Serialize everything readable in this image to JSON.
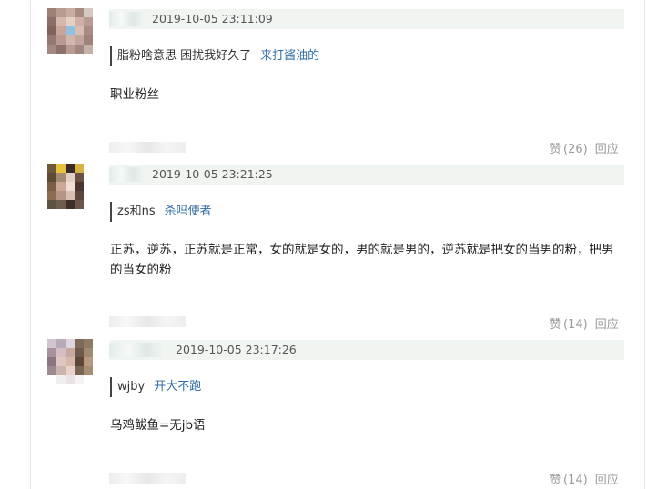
{
  "comments": [
    {
      "timestamp": "2019-10-05 23:11:09",
      "quote_user": "脂粉啥意思 困扰我好久了",
      "quote_text": "来打酱油的",
      "body": "职业粉丝",
      "like_label": "赞",
      "like_count": "(26)",
      "reply_label": "回应"
    },
    {
      "timestamp": "2019-10-05 23:21:25",
      "quote_user": "zs和ns",
      "quote_text": "杀吗使者",
      "body": "正苏，逆苏，正苏就是正常，女的就是女的，男的就是男的，逆苏就是把女的当男的粉，把男的当女的粉",
      "like_label": "赞",
      "like_count": "(14)",
      "reply_label": "回应"
    },
    {
      "timestamp": "2019-10-05 23:17:26",
      "quote_user": "wjby",
      "quote_text": "开大不跑",
      "body": "乌鸡鲅鱼=无jb语",
      "like_label": "赞",
      "like_count": "(14)",
      "reply_label": "回应"
    }
  ]
}
